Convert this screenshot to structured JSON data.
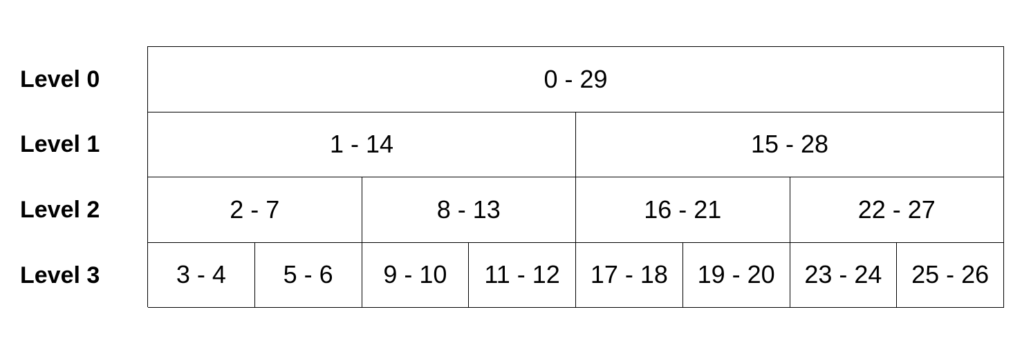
{
  "levels": [
    {
      "label": "Level 0",
      "ranges": [
        "0 - 29"
      ]
    },
    {
      "label": "Level 1",
      "ranges": [
        "1 - 14",
        "15 - 28"
      ]
    },
    {
      "label": "Level 2",
      "ranges": [
        "2 - 7",
        "8 - 13",
        "16 - 21",
        "22 - 27"
      ]
    },
    {
      "label": "Level 3",
      "ranges": [
        "3 - 4",
        "5 - 6",
        "9 - 10",
        "11 - 12",
        "17 - 18",
        "19 - 20",
        "23 - 24",
        "25 - 26"
      ]
    }
  ]
}
